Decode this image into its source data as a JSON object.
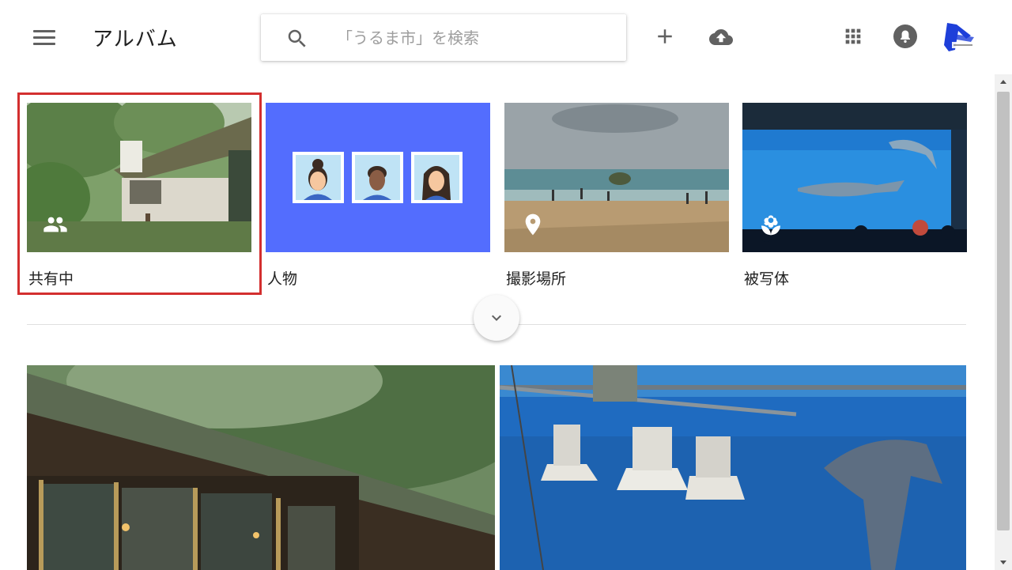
{
  "header": {
    "title": "アルバム",
    "menu_icon": "hamburger-menu-icon",
    "search": {
      "placeholder": "「うるま市」を検索",
      "icon": "search-icon"
    },
    "actions": [
      {
        "name": "add",
        "icon": "plus-icon"
      },
      {
        "name": "upload",
        "icon": "cloud-upload-icon"
      },
      {
        "name": "apps",
        "icon": "apps-grid-icon"
      },
      {
        "name": "notifications",
        "icon": "bell-icon"
      },
      {
        "name": "account",
        "icon": "avatar"
      }
    ]
  },
  "albums": [
    {
      "label": "共有中",
      "icon": "people-icon",
      "selected": true
    },
    {
      "label": "人物"
    },
    {
      "label": "撮影場所",
      "icon": "location-pin-icon"
    },
    {
      "label": "被写体",
      "icon": "flower-icon"
    }
  ],
  "expand_icon": "chevron-down-icon",
  "colors": {
    "highlight": "#d32f2f",
    "people_tile_bg": "#536dfe",
    "icon_gray": "#616161"
  }
}
